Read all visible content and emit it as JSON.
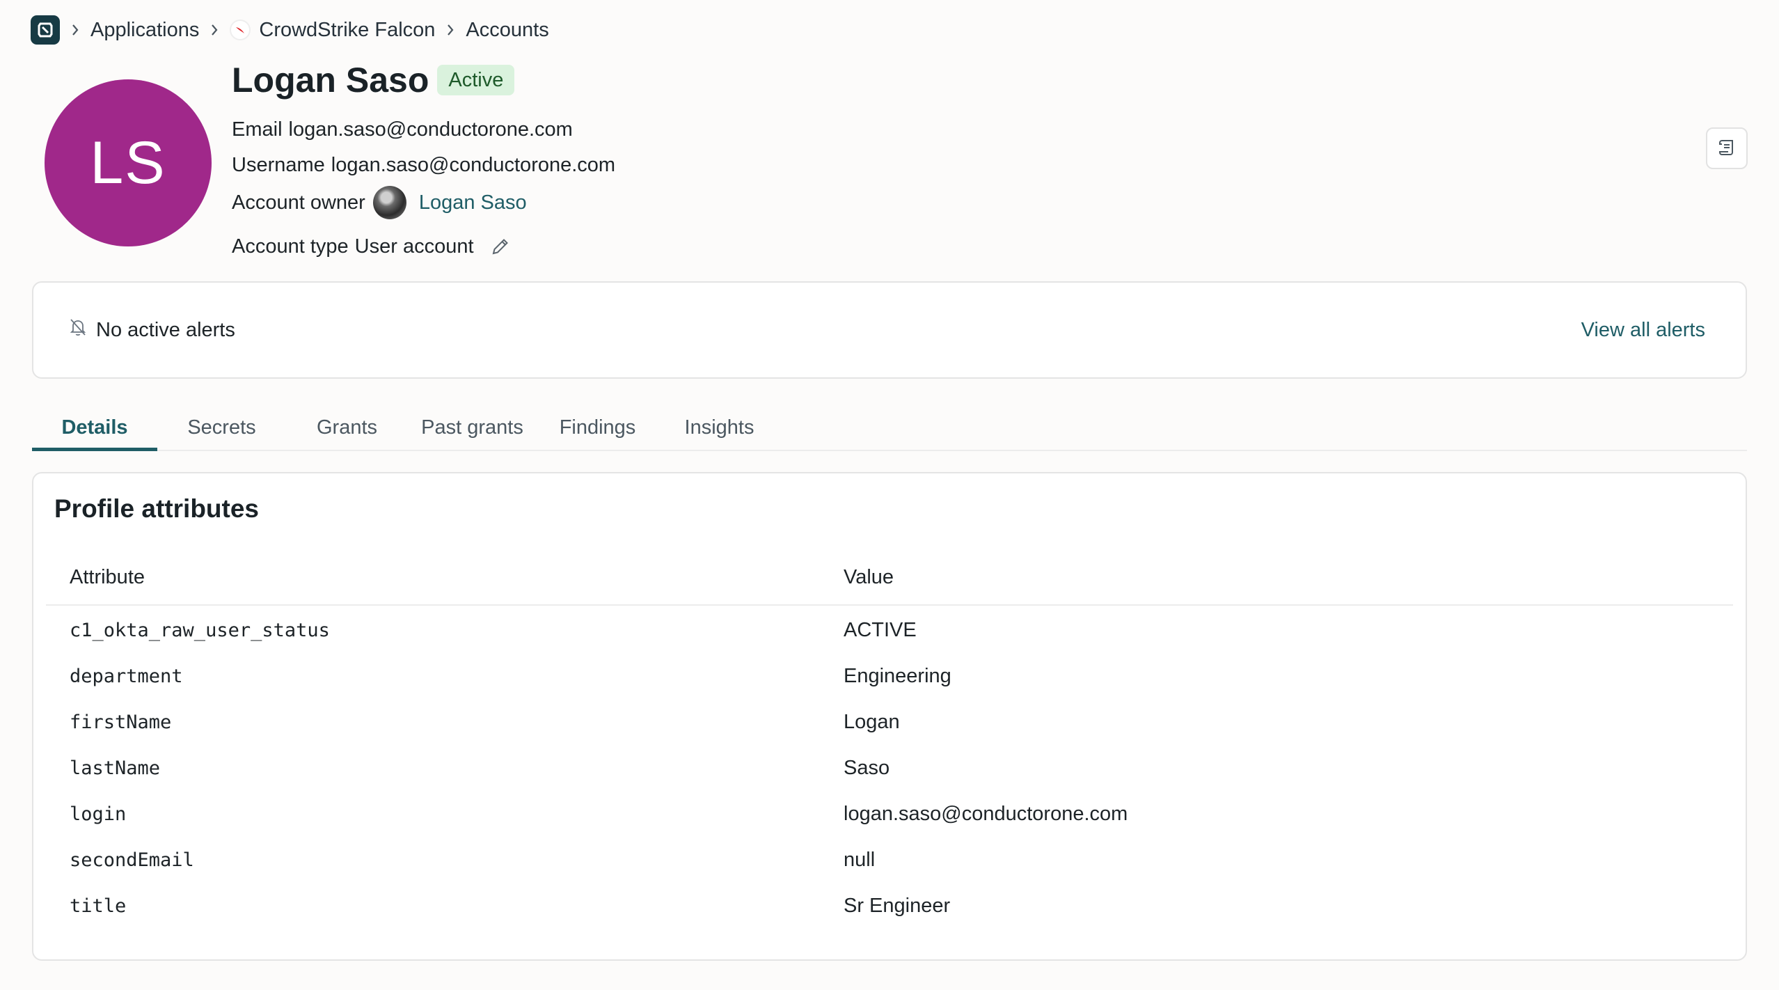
{
  "breadcrumb": {
    "items": [
      "Applications",
      "CrowdStrike Falcon",
      "Accounts"
    ]
  },
  "account": {
    "initials": "LS",
    "name": "Logan Saso",
    "status": "Active",
    "email_label": "Email",
    "email": "logan.saso@conductorone.com",
    "username_label": "Username",
    "username": "logan.saso@conductorone.com",
    "owner_label": "Account owner",
    "owner_name": "Logan Saso",
    "type_label": "Account type",
    "type": "User account"
  },
  "alerts": {
    "message": "No active alerts",
    "view_all": "View all alerts"
  },
  "tabs": [
    "Details",
    "Secrets",
    "Grants",
    "Past grants",
    "Findings",
    "Insights"
  ],
  "active_tab": "Details",
  "profile": {
    "title": "Profile attributes",
    "columns": [
      "Attribute",
      "Value"
    ],
    "rows": [
      {
        "attribute": "c1_okta_raw_user_status",
        "value": "ACTIVE"
      },
      {
        "attribute": "department",
        "value": "Engineering"
      },
      {
        "attribute": "firstName",
        "value": "Logan"
      },
      {
        "attribute": "lastName",
        "value": "Saso"
      },
      {
        "attribute": "login",
        "value": "logan.saso@conductorone.com"
      },
      {
        "attribute": "secondEmail",
        "value": "null"
      },
      {
        "attribute": "title",
        "value": "Sr Engineer"
      }
    ]
  },
  "colors": {
    "accent": "#1f5d66",
    "avatar": "#a0288a",
    "status_bg": "#daf2dd",
    "logo": "#173a44"
  }
}
